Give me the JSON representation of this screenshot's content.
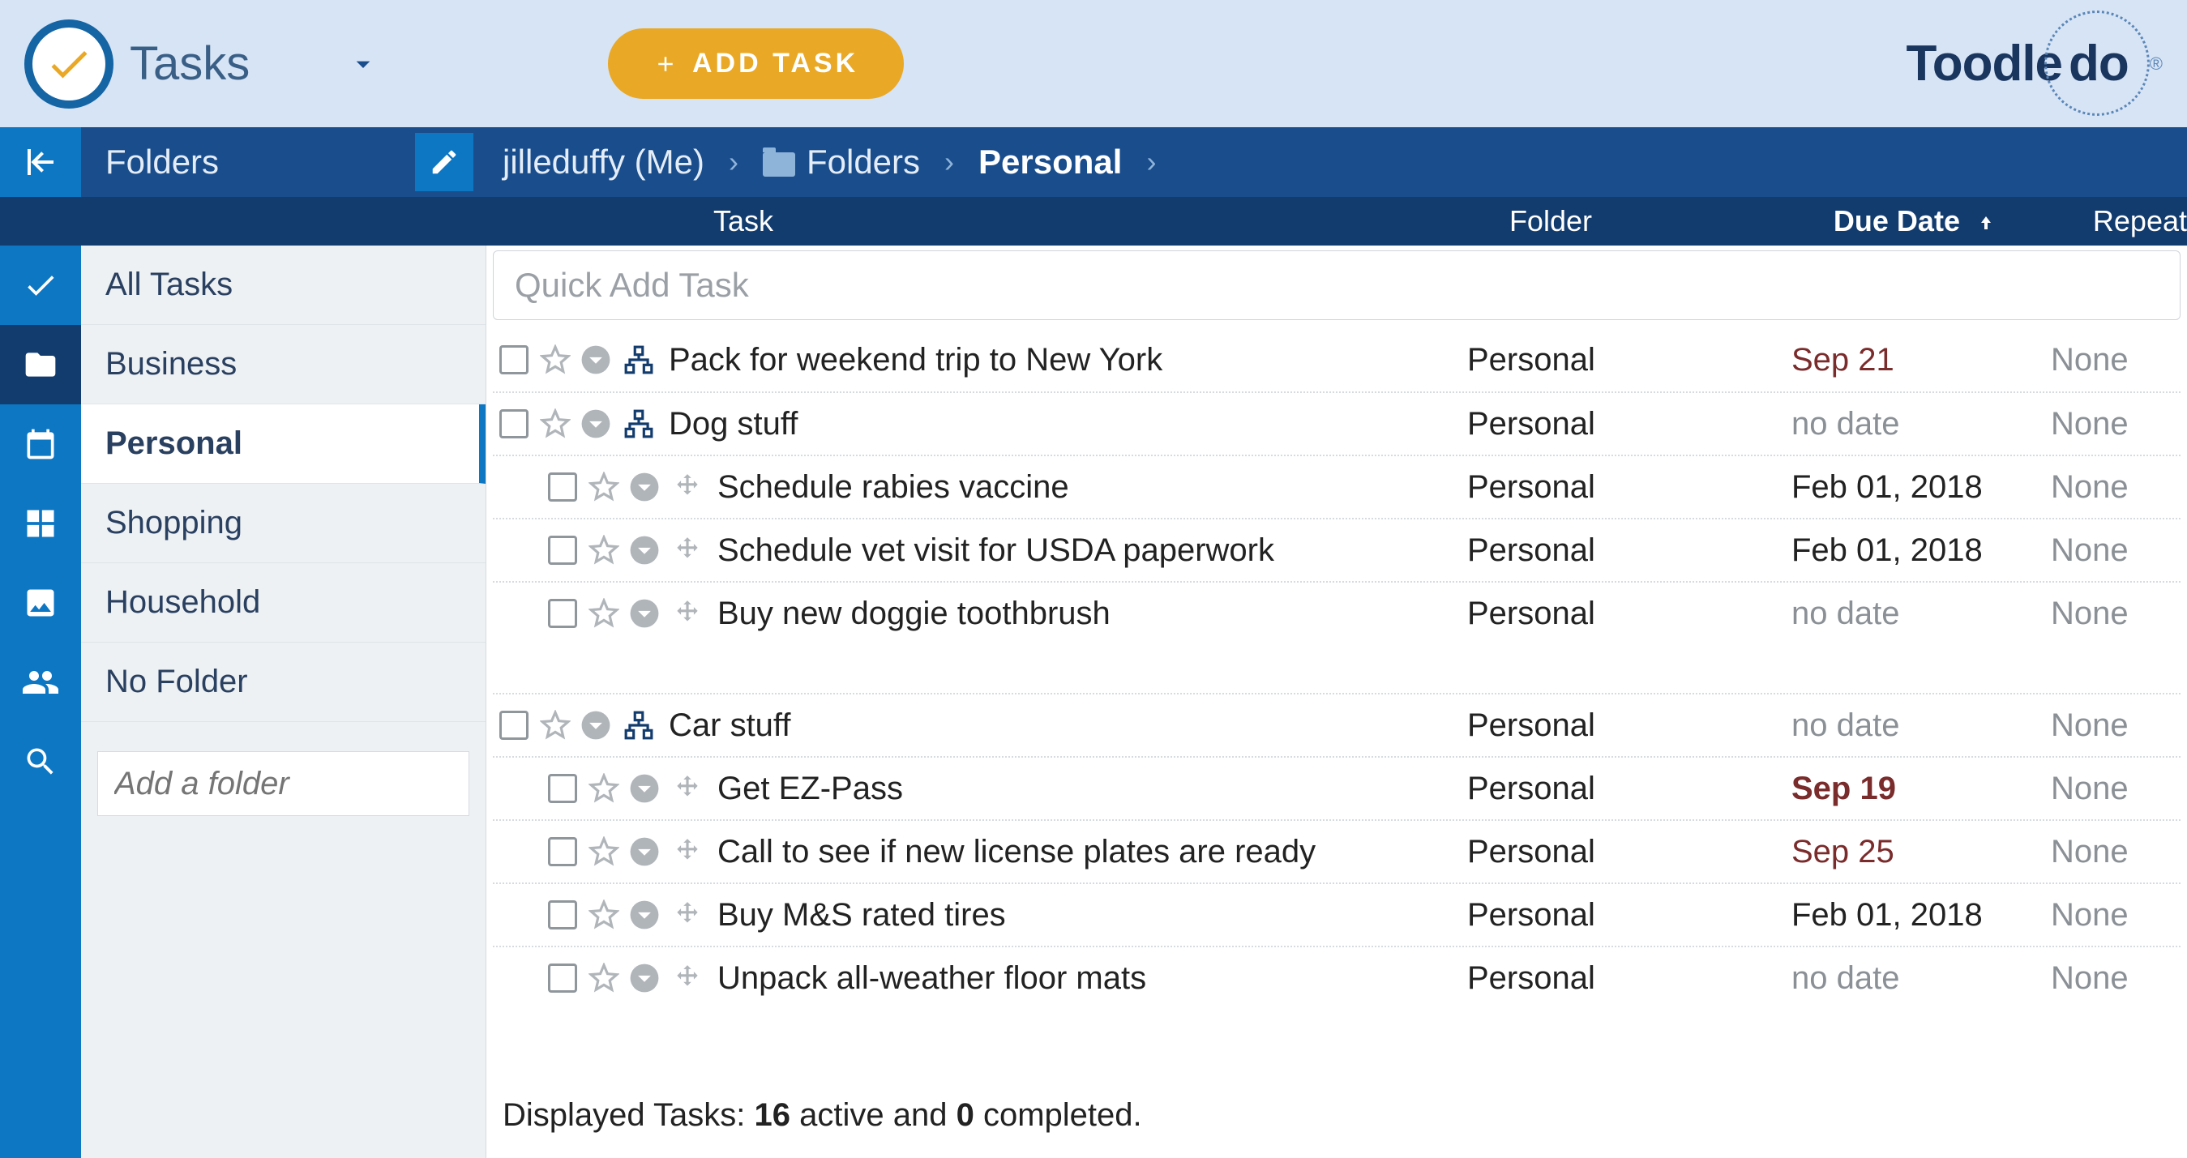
{
  "topbar": {
    "app_title": "Tasks",
    "add_task_label": "ADD TASK",
    "brand_a": "Toodle",
    "brand_b": "do"
  },
  "header": {
    "folders_label": "Folders",
    "breadcrumb_user": "jilleduffy (Me)",
    "breadcrumb_folders": "Folders",
    "breadcrumb_current": "Personal"
  },
  "columns": {
    "task": "Task",
    "folder": "Folder",
    "due": "Due Date",
    "repeat": "Repeat"
  },
  "sidebar": {
    "items": [
      {
        "label": "All Tasks"
      },
      {
        "label": "Business"
      },
      {
        "label": "Personal"
      },
      {
        "label": "Shopping"
      },
      {
        "label": "Household"
      },
      {
        "label": "No Folder"
      }
    ],
    "add_folder_placeholder": "Add a folder"
  },
  "quick_add_placeholder": "Quick Add Task",
  "tasks": [
    {
      "title": "Pack for weekend trip to New York",
      "folder": "Personal",
      "due": "Sep 21",
      "due_style": "date",
      "repeat": "None",
      "parent": true
    },
    {
      "title": "Dog stuff",
      "folder": "Personal",
      "due": "no date",
      "due_style": "nodate",
      "repeat": "None",
      "parent": true
    },
    {
      "title": "Schedule rabies vaccine",
      "folder": "Personal",
      "due": "Feb 01, 2018",
      "due_style": "plain",
      "repeat": "None",
      "sub": true
    },
    {
      "title": "Schedule vet visit for USDA paperwork",
      "folder": "Personal",
      "due": "Feb 01, 2018",
      "due_style": "plain",
      "repeat": "None",
      "sub": true
    },
    {
      "title": "Buy new doggie toothbrush",
      "folder": "Personal",
      "due": "no date",
      "due_style": "nodate",
      "repeat": "None",
      "sub": true
    },
    {
      "gap": true
    },
    {
      "title": "Car stuff",
      "folder": "Personal",
      "due": "no date",
      "due_style": "nodate",
      "repeat": "None",
      "parent": true
    },
    {
      "title": "Get EZ-Pass",
      "folder": "Personal",
      "due": "Sep 19",
      "due_style": "date-bold",
      "repeat": "None",
      "sub": true
    },
    {
      "title": "Call to see if new license plates are ready",
      "folder": "Personal",
      "due": "Sep 25",
      "due_style": "date",
      "repeat": "None",
      "sub": true
    },
    {
      "title": "Buy M&S rated tires",
      "folder": "Personal",
      "due": "Feb 01, 2018",
      "due_style": "plain",
      "repeat": "None",
      "sub": true
    },
    {
      "title": "Unpack all-weather floor mats",
      "folder": "Personal",
      "due": "no date",
      "due_style": "nodate",
      "repeat": "None",
      "sub": true
    }
  ],
  "footer": {
    "prefix": "Displayed Tasks: ",
    "active_count": "16",
    "mid": " active and ",
    "completed_count": "0",
    "suffix": " completed."
  }
}
